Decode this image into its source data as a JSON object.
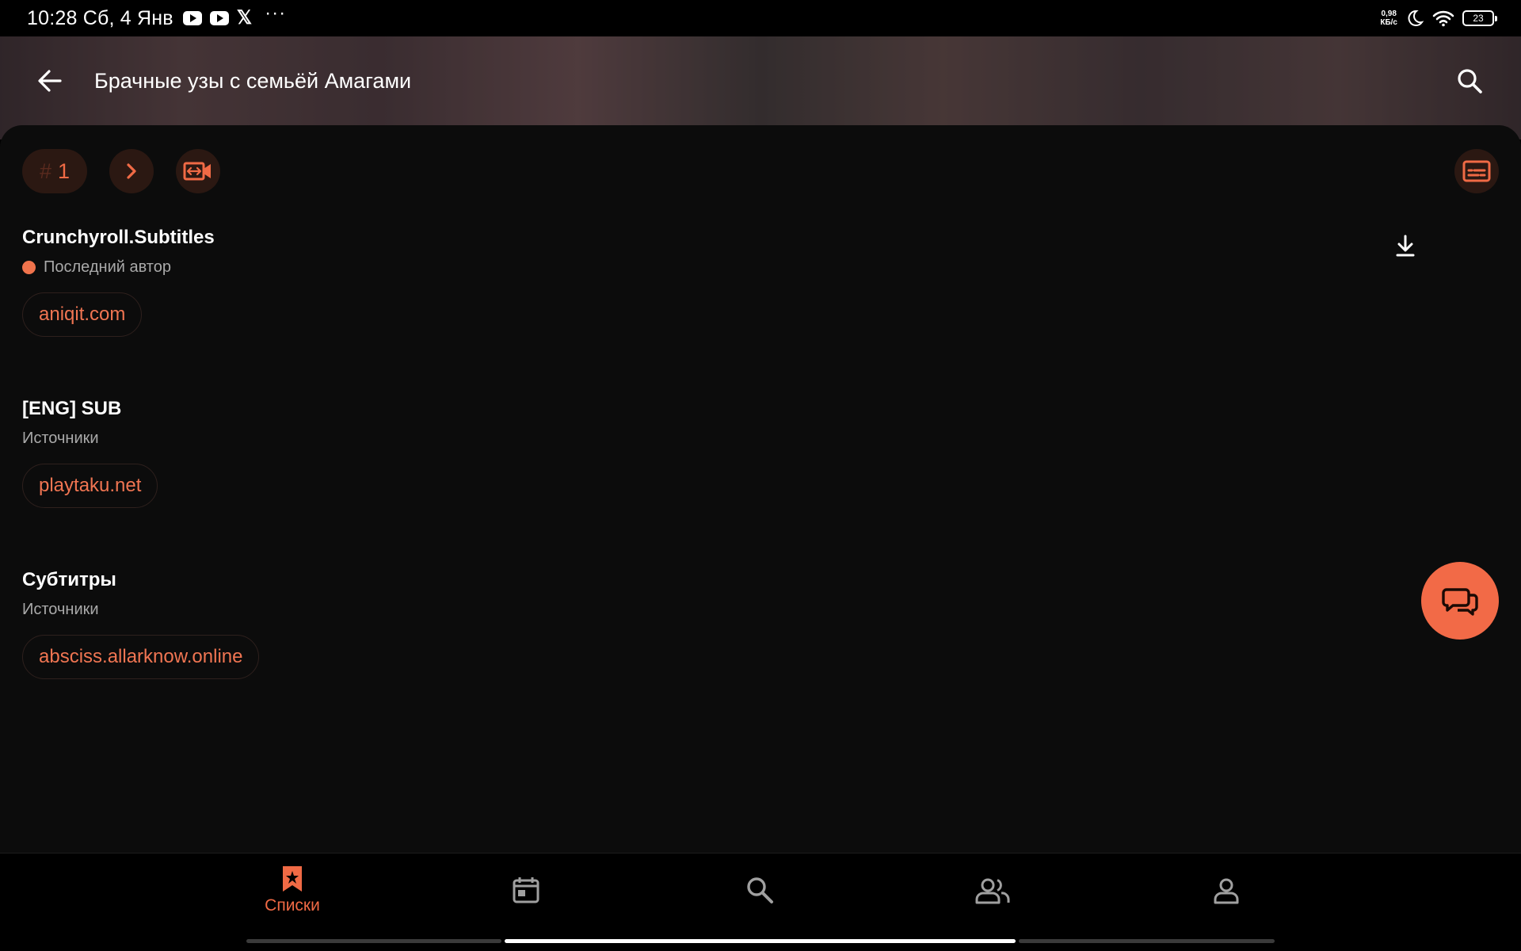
{
  "status_bar": {
    "time": "10:28 Сб, 4 Янв",
    "notifications": [
      "youtube-icon",
      "youtube-icon",
      "x-icon"
    ],
    "more": "···",
    "net_speed_value": "0,98",
    "net_speed_unit": "КБ/с",
    "battery": "23"
  },
  "header": {
    "title": "Брачные узы с семьёй Амагами"
  },
  "toolbar": {
    "hash": "#",
    "episode_number": "1"
  },
  "entries": [
    {
      "title": "Crunchyroll.Subtitles",
      "subtitle": "Последний автор",
      "has_dot": true,
      "link": "aniqit.com",
      "downloadable": true
    },
    {
      "title": "[ENG] SUB",
      "subtitle": "Источники",
      "link": "playtaku.net"
    },
    {
      "title": "Субтитры",
      "subtitle": "Источники",
      "link": "absciss.allarknow.online"
    }
  ],
  "bottom_nav": {
    "items": [
      {
        "icon": "bookmark-star-icon",
        "label": "Списки",
        "active": true
      },
      {
        "icon": "calendar-icon",
        "label": "",
        "active": false
      },
      {
        "icon": "search-icon",
        "label": "",
        "active": false
      },
      {
        "icon": "people-icon",
        "label": "",
        "active": false
      },
      {
        "icon": "person-icon",
        "label": "",
        "active": false
      }
    ]
  },
  "colors": {
    "accent": "#f06a45",
    "background": "#0c0c0c",
    "chip_bg": "#2b1812"
  }
}
